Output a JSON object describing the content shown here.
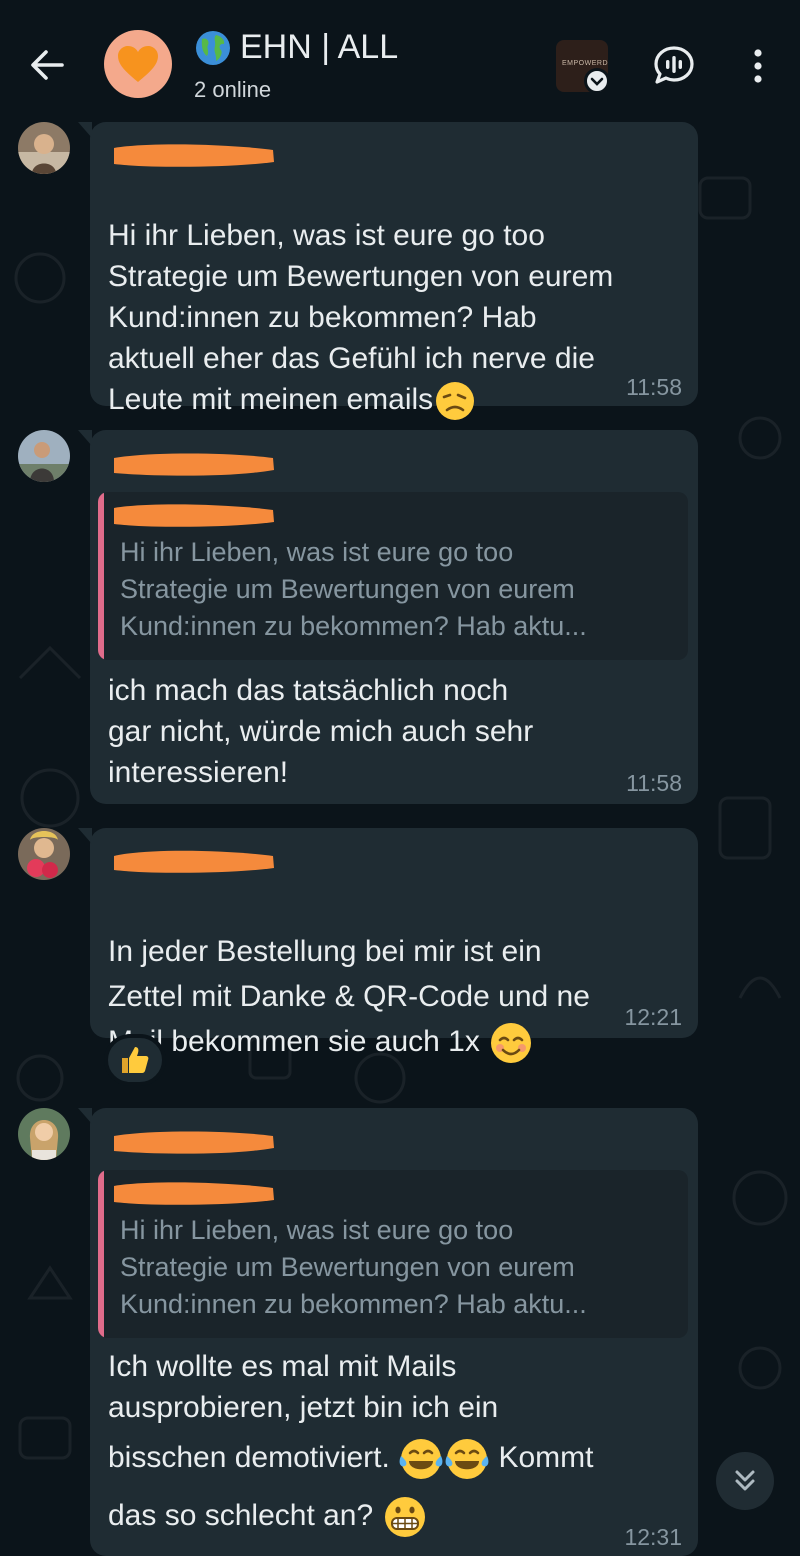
{
  "header": {
    "title": "EHN | ALL",
    "subtitle": "2 online",
    "community_thumb_text": "EMPOWERD"
  },
  "messages": [
    {
      "text": "Hi ihr Lieben, was ist eure go too\nStrategie um Bewertungen von eurem\nKund:innen zu bekommen? Hab\naktuell eher das Gefühl ich nerve die\nLeute mit meinen emails",
      "time": "11:58"
    },
    {
      "quote": "Hi ihr Lieben, was ist eure go too\nStrategie um Bewertungen von eurem\nKund:innen zu bekommen? Hab aktu...",
      "text": "ich mach das tatsächlich noch\ngar nicht, würde mich auch sehr\ninteressieren!",
      "time": "11:58"
    },
    {
      "text": "In jeder Bestellung bei mir ist ein\nZettel mit Danke & QR-Code und ne\nMail bekommen sie auch 1x",
      "time": "12:21",
      "reaction": "thumbs-up"
    },
    {
      "quote": "Hi ihr Lieben, was ist eure go too\nStrategie um Bewertungen von eurem\nKund:innen zu bekommen? Hab aktu...",
      "text_line1": "Ich wollte es mal mit Mails",
      "text_line2": "ausprobieren, jetzt bin ich ein",
      "text_line3_a": "bisschen demotiviert.",
      "text_line3_b": "Kommt",
      "text_line4": "das so schlecht an?",
      "time": "12:31"
    }
  ],
  "colors": {
    "background": "#0b141a",
    "bubble": "#1f2c33",
    "quote_bar": "#e06c8b",
    "redaction": "#f58a3c"
  }
}
